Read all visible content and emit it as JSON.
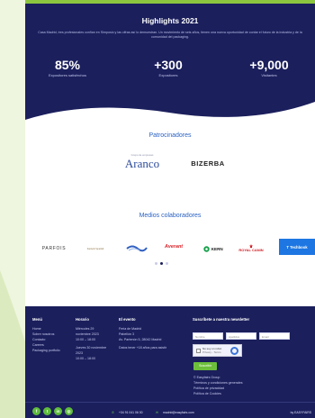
{
  "hero": {
    "title": "Highlights 2021",
    "text": "Casa Madrid, tres profesionales confían en Simposio y las cifras así lo demuestran. Un movimiento de seis años, tienen una nueva oportunidad de contar el futuro de la industria y de la comunidad del packaging.",
    "stats": [
      {
        "value": "85%",
        "label": "Expositores satisfechos"
      },
      {
        "value": "+300",
        "label": "Expositores"
      },
      {
        "value": "+9,000",
        "label": "Visitantes"
      }
    ]
  },
  "sponsors": {
    "title": "Patrocinadores",
    "logos": [
      {
        "name": "Aranco",
        "tagline": "Grupo de empresas"
      },
      {
        "name": "BIZERBA"
      }
    ]
  },
  "media": {
    "title": "Medios colaboradores",
    "logos": [
      "PARFOIS",
      "Kernels Spanish",
      "SCHWEPPES",
      "Averant",
      "KERN",
      "ROYAL CANIN",
      "T Techbook"
    ],
    "page_indicator": {
      "current": 2,
      "total": 3
    }
  },
  "footer": {
    "menu": {
      "heading": "Menú",
      "items": [
        "Home",
        "Sobre nosotros",
        "Contacto",
        "Careers",
        "Packaging portfolio"
      ]
    },
    "hours": {
      "heading": "Horario",
      "items": [
        "Miércoles 29",
        "noviembre 2023",
        "10:00 – 18:00",
        "",
        "Jueves 30 noviembre",
        "2023",
        "10:00 – 18:00"
      ]
    },
    "event": {
      "heading": "El evento",
      "items": [
        "Feria de Madrid",
        "Pabellón 3",
        "Av. Partenón 5, 28042 Madrid",
        "",
        "Datos tener +18 años para asistir"
      ]
    },
    "newsletter": {
      "heading": "Suscríbete a nuestra newsletter",
      "name_placeholder": "Nombre",
      "surname_placeholder": "Apellidos",
      "email_placeholder": "Email",
      "captcha_label": "No soy un robot",
      "captcha_sub": "Privacy - Terms",
      "subscribe_label": "Suscribir",
      "links": [
        "© Easyfairs Group",
        "Términos y condiciones generales",
        "Política de privacidad",
        "Política de Cookies"
      ]
    },
    "social": [
      {
        "icon": "facebook-icon",
        "glyph": "f"
      },
      {
        "icon": "twitter-icon",
        "glyph": "t"
      },
      {
        "icon": "linkedin-icon",
        "glyph": "in"
      },
      {
        "icon": "instagram-icon",
        "glyph": "◎"
      }
    ],
    "phone": "+34 91 041 06 00",
    "email": "madrid@easyfairs.com",
    "credit": "by EASYFAIRS"
  }
}
